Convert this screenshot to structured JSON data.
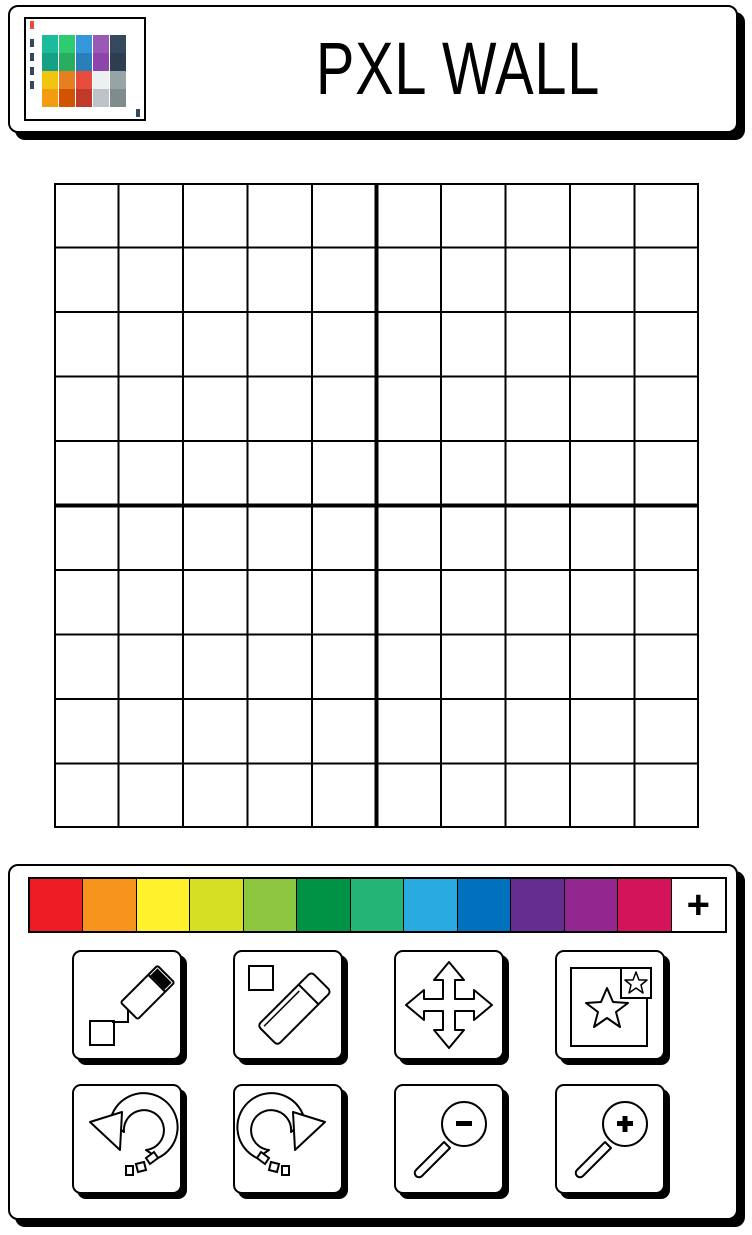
{
  "header": {
    "title": "PXL WALL",
    "logo_icon": "palette-logo-icon"
  },
  "canvas": {
    "rows": 10,
    "cols": 10,
    "major_divider_every": 5,
    "cell_color": "#ffffff",
    "line_color": "#000000"
  },
  "palette": {
    "colors": [
      "#ee1c25",
      "#f7941d",
      "#fff22d",
      "#d7df23",
      "#8dc63f",
      "#009245",
      "#22b573",
      "#29abe2",
      "#0071bc",
      "#662d91",
      "#93278f",
      "#d4145a"
    ],
    "add_label": "+"
  },
  "tools": [
    {
      "id": "pencil",
      "icon": "pencil-icon"
    },
    {
      "id": "eraser",
      "icon": "eraser-icon"
    },
    {
      "id": "move",
      "icon": "move-arrows-icon"
    },
    {
      "id": "stamp",
      "icon": "stamp-star-icon"
    },
    {
      "id": "undo",
      "icon": "undo-icon"
    },
    {
      "id": "redo",
      "icon": "redo-icon"
    },
    {
      "id": "zoom_out",
      "icon": "zoom-out-icon"
    },
    {
      "id": "zoom_in",
      "icon": "zoom-in-icon"
    }
  ]
}
